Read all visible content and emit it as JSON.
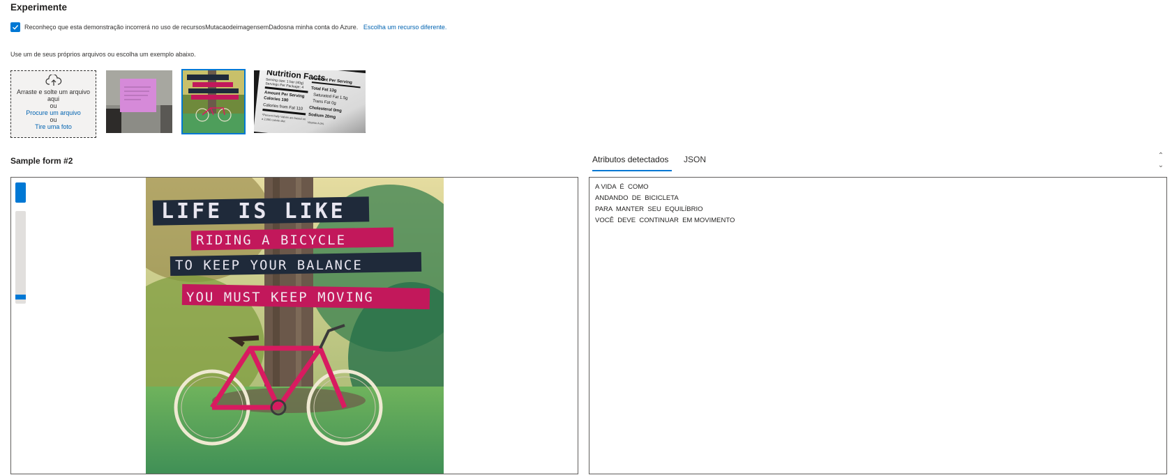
{
  "header": {
    "title": "Experimente",
    "consent_text": "Reconheço que esta demonstração incorrerá no uso de recursosMutacaodeimagensemDadosna minha conta do Azure.",
    "consent_link": "Escolha um recurso diferente.",
    "consent_checked": true
  },
  "upload": {
    "instruction": "Use um de seus próprios arquivos ou escolha um exemplo abaixo.",
    "drop_line1": "Arraste e solte um arquivo",
    "drop_line2": "aqui",
    "or1": "ou",
    "browse_link": "Procure um arquivo",
    "or2": "ou",
    "photo_link": "Tire uma foto"
  },
  "samples": {
    "selected_index": 1,
    "items": [
      {
        "name": "sticky-note"
      },
      {
        "name": "life-is-like-bicycle"
      },
      {
        "name": "nutrition-facts"
      }
    ]
  },
  "nutrition": {
    "title": "Nutrition Facts",
    "serving": "Serving size: 1 bar (40g)",
    "per_package": "Servings Per Package: 4",
    "amount_per_serving": "Amount Per Serving",
    "calories": "Calories 190",
    "calories_fat": "Calories from Fat 110",
    "daily_note": "*Percent Daily Values are based on",
    "calorie_diet": "a 2,000 calorie diet",
    "amount_per_serving_col": "Amount Per Serving",
    "total_fat": "Total Fat 13g",
    "saturated_fat": "Saturated Fat 1.5g",
    "trans_fat": "Trans Fat 0g",
    "cholesterol": "Cholesterol 0mg",
    "sodium": "Sodium 20mg",
    "vitamin": "Vitamin A 0%"
  },
  "viewer": {
    "title": "Sample form #2",
    "image_lines": [
      "LIFE IS LIKE",
      "RIDING A BICYCLE",
      "TO KEEP YOUR BALANCE",
      "YOU MUST KEEP MOVING"
    ],
    "zoom_level": 0
  },
  "tabs": {
    "active": "Atributos detectados",
    "other": "JSON"
  },
  "results": {
    "lines": [
      "A VIDA  É  COMO",
      "ANDANDO  DE  BICICLETA",
      "PARA  MANTER  SEU  EQUILÍBRIO",
      "VOCÊ  DEVE  CONTINUAR  EM MOVIMENTO"
    ]
  },
  "colors": {
    "accent": "#0078d4",
    "link": "#0063b1",
    "label_pink": "#c2185b",
    "label_dark": "#1f2a3a"
  }
}
